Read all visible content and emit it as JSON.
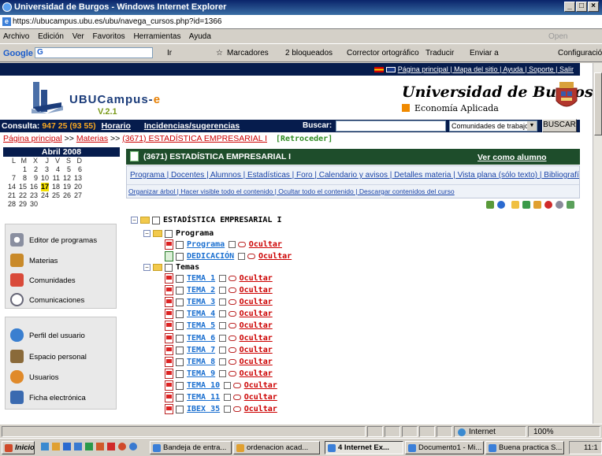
{
  "window": {
    "title": "Universidad de Burgos - Windows Internet Explorer",
    "url": "https://ubucampus.ubu.es/ubu/navega_cursos.php?id=1366"
  },
  "menu": [
    "Archivo",
    "Edición",
    "Ver",
    "Favoritos",
    "Herramientas",
    "Ayuda"
  ],
  "toolbar": {
    "google": "Google",
    "g": "G",
    "ir": "Ir",
    "marcadores": "Marcadores",
    "bloqueados": "2 bloqueados",
    "corrector": "Corrector ortográfico",
    "traducir": "Traducir",
    "enviar": "Enviar a",
    "config": "Configuración",
    "open": "Open"
  },
  "site": {
    "toplinks": "Página principal | Mapa del sitio | Ayuda | Soporte | Salir",
    "logo_main": "UBUCampus-",
    "logo_e": "e",
    "version": "V.2.1",
    "university": "Universidad de Burgos",
    "department": "Economía Aplicada",
    "consulta_label": "Consulta:",
    "consulta_phone": "947 25 (93 55)",
    "horario": "Horario",
    "incidencias": "Incidencias/sugerencias",
    "buscar_label": "Buscar:",
    "select_value": "Comunidades de trabajo",
    "buscar_button": "BUSCAR"
  },
  "breadcrumb": {
    "home": "Página principal",
    "sep": ">>",
    "materias": "Materias",
    "course": "(3671) ESTADÍSTICA EMPRESARIAL I",
    "back": "[Retroceder]"
  },
  "calendar": {
    "title": "Abril 2008",
    "days": [
      "L",
      "M",
      "X",
      "J",
      "V",
      "S",
      "D"
    ],
    "weeks": [
      [
        "",
        "1",
        "2",
        "3",
        "4",
        "5",
        "6"
      ],
      [
        "7",
        "8",
        "9",
        "10",
        "11",
        "12",
        "13"
      ],
      [
        "14",
        "15",
        "16",
        "17",
        "18",
        "19",
        "20"
      ],
      [
        "21",
        "22",
        "23",
        "24",
        "25",
        "26",
        "27"
      ],
      [
        "28",
        "29",
        "30",
        "",
        "",
        "",
        ""
      ]
    ],
    "today": "17"
  },
  "sidebar": {
    "group1": [
      "Editor de programas",
      "Materias",
      "Comunidades",
      "Comunicaciones"
    ],
    "group2": [
      "Perfil del usuario",
      "Espacio personal",
      "Usuarios",
      "Ficha electrónica"
    ]
  },
  "course": {
    "title": "(3671) ESTADÍSTICA EMPRESARIAL I",
    "ver_como": "Ver como alumno",
    "links1": "Programa | Docentes | Alumnos | Estadísticas | Foro | Calendario y avisos | Detalles materia | Vista plana (sólo texto) | Bibliografía",
    "links2": "Organizar árbol | Hacer visible todo el contenido  |  Ocultar todo el contenido | Descargar contenidos del curso"
  },
  "tree": {
    "root": "ESTADÍSTICA EMPRESARIAL I",
    "programa_folder": "Programa",
    "programa_items": [
      "Programa",
      "DEDICACIÓN"
    ],
    "temas_folder": "Temas",
    "temas_items": [
      "TEMA 1",
      "TEMA 2",
      "TEMA 3",
      "TEMA 4",
      "TEMA 5",
      "TEMA 6",
      "TEMA 7",
      "TEMA 8",
      "TEMA 9",
      "TEMA 10",
      "TEMA 11",
      "IBEX 35"
    ],
    "hide_label": "Ocultar"
  },
  "status": {
    "zone": "Internet",
    "zoom": "100%"
  },
  "taskbar": {
    "start": "Inicio",
    "items": [
      "Bandeja de entra...",
      "ordenacion acad...",
      "4 Internet Ex...",
      "Documento1 - Mi...",
      "Buena practica S..."
    ],
    "clock": "11:1"
  }
}
